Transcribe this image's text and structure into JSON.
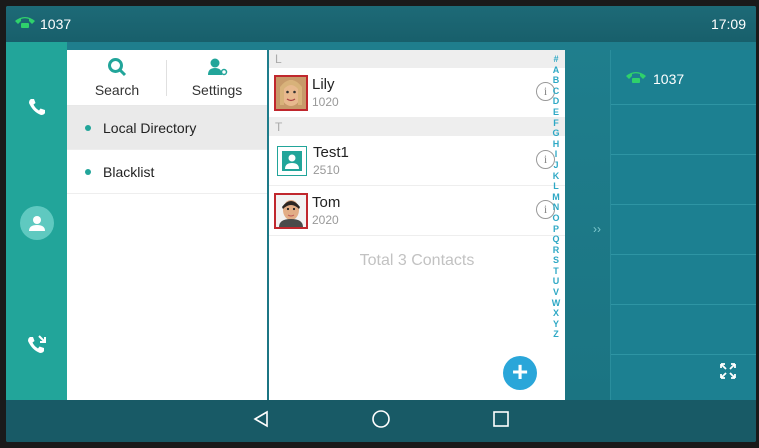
{
  "status": {
    "line": "1037",
    "time": "17:09"
  },
  "toolbar": {
    "search_label": "Search",
    "settings_label": "Settings"
  },
  "sidebar": {
    "items": [
      {
        "label": "Local Directory",
        "active": true
      },
      {
        "label": "Blacklist",
        "active": false
      }
    ]
  },
  "contacts": {
    "sections": [
      {
        "letter": "L"
      },
      {
        "letter": "T"
      }
    ],
    "items": [
      {
        "name": "Lily",
        "number": "1020",
        "photo": "lily-photo"
      },
      {
        "name": "Test1",
        "number": "2510",
        "photo": "default-contact-icon"
      },
      {
        "name": "Tom",
        "number": "2020",
        "photo": "tom-photo"
      }
    ],
    "total": "Total 3 Contacts",
    "alphabet": [
      "#",
      "A",
      "B",
      "C",
      "D",
      "E",
      "F",
      "G",
      "H",
      "I",
      "J",
      "K",
      "L",
      "M",
      "N",
      "O",
      "P",
      "Q",
      "R",
      "S",
      "T",
      "U",
      "V",
      "W",
      "X",
      "Y",
      "Z"
    ]
  },
  "line_panel": {
    "line": "1037"
  },
  "colors": {
    "accent": "#22a59a",
    "fab": "#2aa6d9",
    "line_icon": "#2fd16b"
  }
}
